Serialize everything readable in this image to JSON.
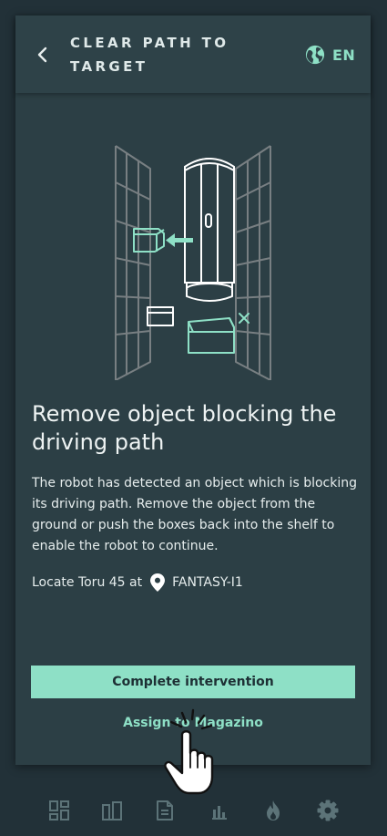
{
  "header": {
    "back_icon": "chevron-left-icon",
    "title": "CLEAR PATH TO TARGET",
    "language_icon": "globe-icon",
    "language": "EN"
  },
  "content": {
    "heading": "Remove object blocking the driving path",
    "description": "The robot has detected an object which is blocking its driving path. Remove the object from the ground or push the boxes back into the shelf to enable the robot to continue.",
    "locate_prefix": "Locate Toru 45 at",
    "location_icon": "map-pin-icon",
    "location": "FANTASY-I1"
  },
  "actions": {
    "primary_label": "Complete intervention",
    "secondary_label": "Assign to Magazino"
  },
  "tabbar": {
    "items": [
      "dashboard-icon",
      "shelves-icon",
      "document-icon",
      "bar-chart-icon",
      "flame-icon",
      "gear-icon"
    ]
  },
  "colors": {
    "background": "#223138",
    "card": "#2c3f45",
    "accent": "#8ee0c6",
    "text": "#eef3f3",
    "icon_muted": "#5c7378"
  }
}
